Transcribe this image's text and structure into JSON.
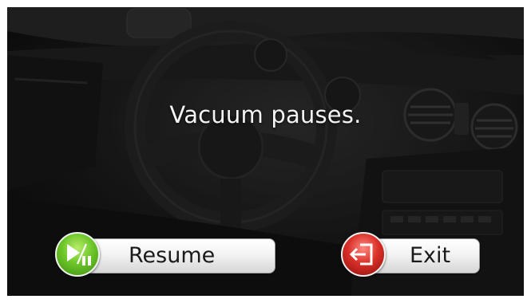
{
  "dialog": {
    "message": "Vacuum pauses."
  },
  "buttons": {
    "resume_label": "Resume",
    "exit_label": "Exit"
  },
  "icons": {
    "resume": "play-pause-icon",
    "exit": "exit-door-icon"
  },
  "colors": {
    "resume_accent": "#6cc629",
    "exit_accent": "#d93028",
    "message_text": "#f4f4f4",
    "button_text": "#1a1a1a"
  }
}
